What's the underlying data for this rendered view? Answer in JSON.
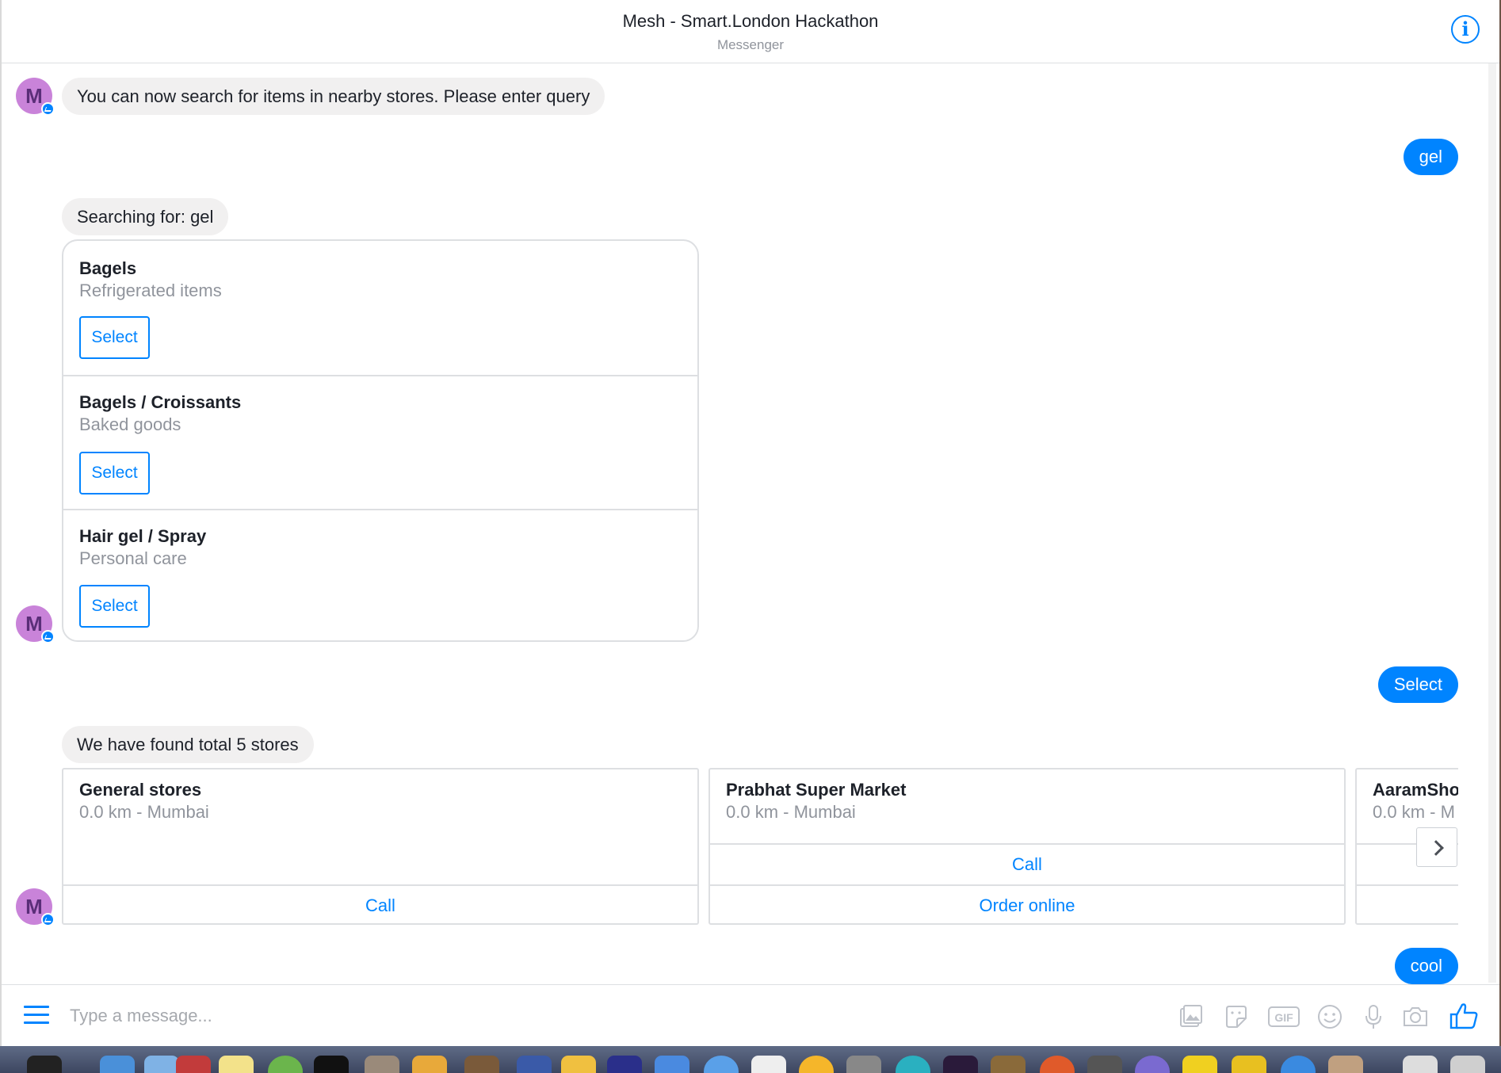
{
  "header": {
    "title": "Mesh - Smart.London Hackathon",
    "subtitle": "Messenger",
    "info_icon": "info-icon"
  },
  "avatar_letter": "M",
  "messages": {
    "bot_intro": "You can now search for items in nearby stores. Please enter query",
    "user_query": "gel",
    "bot_searching": "Searching for: gel",
    "user_select": "Select",
    "bot_found": "We have found total 5 stores",
    "user_cool": "cool"
  },
  "search_results": [
    {
      "title": "Bagels",
      "subtitle": "Refrigerated items",
      "button": "Select"
    },
    {
      "title": "Bagels / Croissants",
      "subtitle": "Baked goods",
      "button": "Select"
    },
    {
      "title": "Hair gel / Spray",
      "subtitle": "Personal care",
      "button": "Select"
    }
  ],
  "stores": [
    {
      "name": "General stores",
      "detail": "0.0 km - Mumbai",
      "actions": [
        "Call"
      ]
    },
    {
      "name": "Prabhat Super Market",
      "detail": "0.0 km - Mumbai",
      "actions": [
        "Call",
        "Order online"
      ]
    },
    {
      "name": "AaramSho",
      "detail": "0.0 km - M"
    }
  ],
  "composer": {
    "placeholder": "Type a message...",
    "tools": [
      "image-icon",
      "sticker-icon",
      "gif-icon",
      "emoji-icon",
      "microphone-icon",
      "camera-icon",
      "thumbs-up-icon"
    ],
    "gif_label": "GIF"
  },
  "colors": {
    "accent": "#0084ff",
    "bubble_gray": "#f1f0f0",
    "avatar": "#c983d9",
    "muted_text": "#90949c"
  }
}
